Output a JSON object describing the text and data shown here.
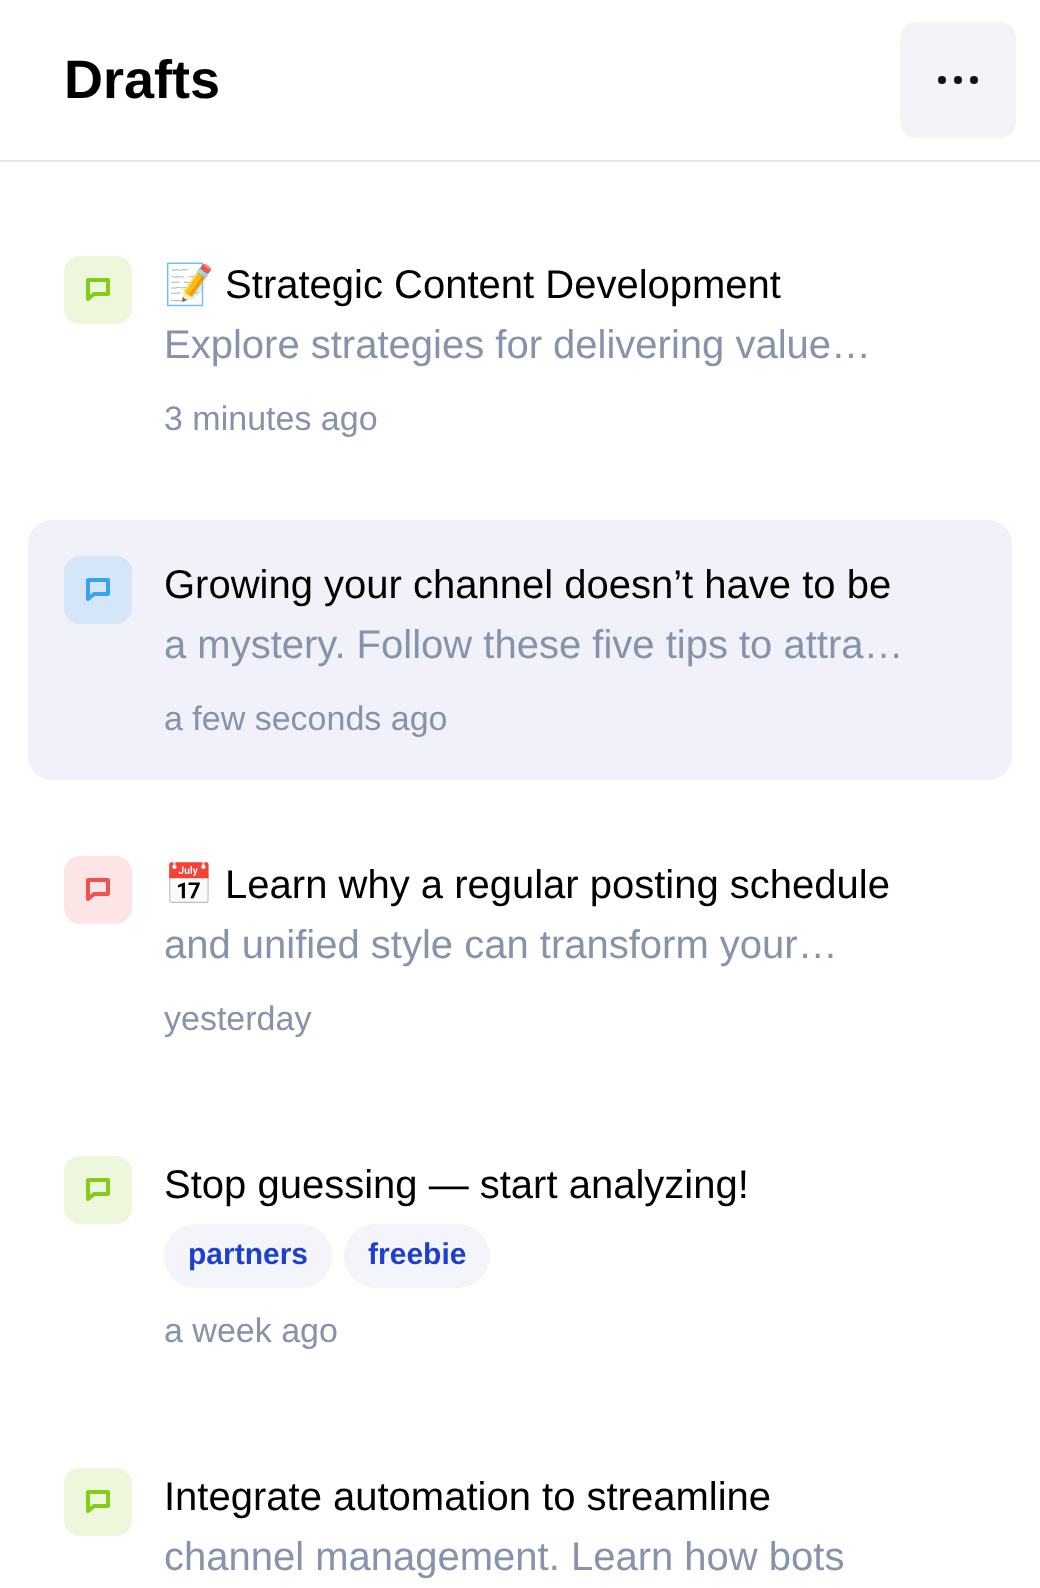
{
  "header": {
    "title": "Drafts"
  },
  "drafts": [
    {
      "title": "📝 Strategic Content Development",
      "preview": "Explore strategies for delivering value…",
      "time": "3 minutes ago",
      "color": "#84cc16",
      "selected": false
    },
    {
      "title": "Growing your channel doesn’t have to be",
      "preview": "a mystery. Follow these five tips to attra…",
      "time": "a few seconds ago",
      "color": "#38a3f1",
      "selected": true
    },
    {
      "title": "📅 Learn why a regular posting schedule",
      "preview": "and unified style can transform your…",
      "time": "yesterday",
      "color": "#f05252",
      "selected": false
    },
    {
      "title": "Stop guessing — start analyzing!",
      "tags": [
        "partners",
        "freebie"
      ],
      "time": "a week ago",
      "color": "#84cc16",
      "selected": false
    },
    {
      "title": "Integrate automation to streamline",
      "preview": "channel management. Learn how bots",
      "color": "#84cc16",
      "selected": false
    }
  ]
}
